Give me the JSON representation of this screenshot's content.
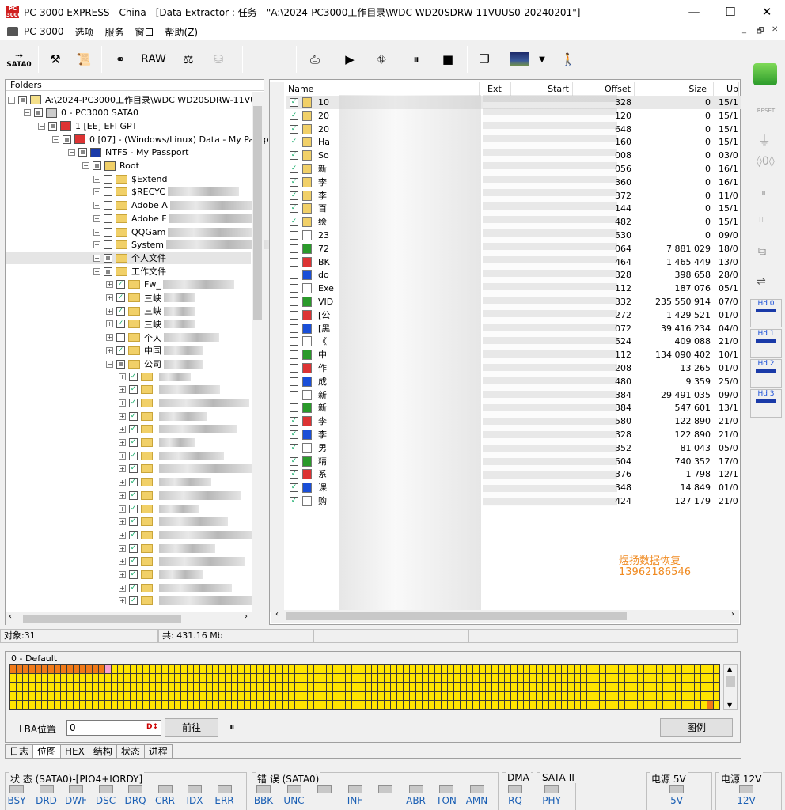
{
  "window": {
    "icon_text": "PC 3000",
    "title": "PC-3000 EXPRESS - China - [Data Extractor : 任务 - \"A:\\2024-PC3000工作目录\\WDC WD20SDRW-11VUUS0-20240201\"]",
    "minimize": "—",
    "maximize": "☐",
    "close": "✕"
  },
  "menu": {
    "items": [
      "PC-3000",
      "选项",
      "服务",
      "窗口",
      "帮助(Z)"
    ],
    "mdi": [
      "_",
      "🗗",
      "✕"
    ]
  },
  "toolbar": {
    "sata_label": "SATA0",
    "raw_label": "RAW"
  },
  "folders": {
    "header": "Folders",
    "rows": [
      {
        "label": "A:\\2024-PC3000工作目录\\WDC WD20SDRW-11VU",
        "blur": 0
      },
      {
        "label": "0 - PC3000 SATA0",
        "blur": 0
      },
      {
        "label": "1 [EE] EFI GPT",
        "blur": 0
      },
      {
        "label": "0 [07] - (Windows/Linux) Data - My Passpo",
        "blur": 0
      },
      {
        "label": "NTFS - My Passport",
        "blur": 0
      },
      {
        "label": "Root",
        "blur": 0
      },
      {
        "label": "$Extend",
        "blur": 0
      },
      {
        "label": "$RECYC",
        "blur": 90
      },
      {
        "label": "Adobe A",
        "blur": 110
      },
      {
        "label": "Adobe F",
        "blur": 120
      },
      {
        "label": "QQGam",
        "blur": 110
      },
      {
        "label": "System",
        "blur": 130
      },
      {
        "label": "个人文件",
        "blur": 0
      },
      {
        "label": "工作文件",
        "blur": 0
      },
      {
        "label": "Fw_",
        "blur": 90
      },
      {
        "label": "三峡",
        "blur": 40
      },
      {
        "label": "三峡",
        "blur": 40
      },
      {
        "label": "三峡",
        "blur": 40
      },
      {
        "label": "个人",
        "blur": 70
      },
      {
        "label": "中国",
        "blur": 50
      },
      {
        "label": "公司",
        "blur": 50
      }
    ],
    "sub_rows": 18
  },
  "filelist": {
    "columns": [
      "Name",
      "Ext",
      "Start",
      "Offset",
      "Size",
      "Up"
    ],
    "rows": [
      {
        "name": "10",
        "offset": "328",
        "size": "0",
        "date": "15/1"
      },
      {
        "name": "20",
        "offset": "120",
        "size": "0",
        "date": "15/1"
      },
      {
        "name": "20",
        "offset": "648",
        "size": "0",
        "date": "15/1"
      },
      {
        "name": "Ha",
        "offset": "160",
        "size": "0",
        "date": "15/1"
      },
      {
        "name": "So",
        "offset": "008",
        "size": "0",
        "date": "03/0"
      },
      {
        "name": "新",
        "offset": "056",
        "size": "0",
        "date": "16/1"
      },
      {
        "name": "李",
        "offset": "360",
        "size": "0",
        "date": "16/1"
      },
      {
        "name": "李",
        "offset": "372",
        "size": "0",
        "date": "11/0"
      },
      {
        "name": "百",
        "offset": "144",
        "size": "0",
        "date": "15/1"
      },
      {
        "name": "绘",
        "offset": "482",
        "size": "0",
        "date": "15/1"
      },
      {
        "name": "23",
        "offset": "530",
        "size": "0",
        "date": "09/0"
      },
      {
        "name": "72",
        "offset": "064",
        "size": "7 881 029",
        "date": "18/0"
      },
      {
        "name": "BK",
        "offset": "464",
        "size": "1 465 449",
        "date": "13/0"
      },
      {
        "name": "do",
        "offset": "328",
        "size": "398 658",
        "date": "28/0"
      },
      {
        "name": "Exe",
        "offset": "112",
        "size": "187 076",
        "date": "05/1"
      },
      {
        "name": "VID",
        "offset": "332",
        "size": "235 550 914",
        "date": "07/0"
      },
      {
        "name": "[公",
        "offset": "272",
        "size": "1 429 521",
        "date": "01/0"
      },
      {
        "name": "[黑",
        "offset": "072",
        "size": "39 416 234",
        "date": "04/0"
      },
      {
        "name": "《",
        "offset": "524",
        "size": "409 088",
        "date": "21/0"
      },
      {
        "name": "中",
        "offset": "112",
        "size": "134 090 402",
        "date": "10/1"
      },
      {
        "name": "作",
        "offset": "208",
        "size": "13 265",
        "date": "01/0"
      },
      {
        "name": "成",
        "offset": "480",
        "size": "9 359",
        "date": "25/0"
      },
      {
        "name": "新",
        "offset": "384",
        "size": "29 491 035",
        "date": "09/0"
      },
      {
        "name": "新",
        "offset": "384",
        "size": "547 601",
        "date": "13/1"
      },
      {
        "name": "李",
        "offset": "580",
        "size": "122 890",
        "date": "21/0"
      },
      {
        "name": "李",
        "offset": "328",
        "size": "122 890",
        "date": "21/0"
      },
      {
        "name": "男",
        "offset": "352",
        "size": "81 043",
        "date": "05/0"
      },
      {
        "name": "精",
        "offset": "504",
        "size": "740 352",
        "date": "17/0"
      },
      {
        "name": "系",
        "offset": "376",
        "size": "1 798",
        "date": "12/1"
      },
      {
        "name": "课",
        "offset": "348",
        "size": "14 849",
        "date": "01/0"
      },
      {
        "name": "购",
        "offset": "424",
        "size": "127 179",
        "date": "21/0"
      }
    ],
    "watermark_line1": "煜扬数据恢复",
    "watermark_line2": "13962186546"
  },
  "status": {
    "objects": "对象:31",
    "total": "共: 431.16 Mb"
  },
  "map": {
    "label": "0 - Default",
    "lba_label": "LBA位置",
    "lba_value": "0",
    "go_button": "前往",
    "pause": "⏸",
    "legend_button": "图例"
  },
  "tabs": [
    "日志",
    "位图",
    "HEX",
    "结构",
    "状态",
    "进程"
  ],
  "leds": {
    "state_title": "状 态 (SATA0)-[PIO4+IORDY]",
    "state": [
      "BSY",
      "DRD",
      "DWF",
      "DSC",
      "DRQ",
      "CRR",
      "IDX",
      "ERR"
    ],
    "error_title": "错 误 (SATA0)",
    "error": [
      "BBK",
      "UNC",
      "",
      "INF",
      "",
      "ABR",
      "TON",
      "AMN"
    ],
    "dma_title": "DMA",
    "dma": [
      "RQ"
    ],
    "sata_title": "SATA-II",
    "sata": [
      "PHY"
    ],
    "p5_title": "电源 5V",
    "p5": [
      "5V"
    ],
    "p12_title": "电源 12V",
    "p12": [
      "12V"
    ]
  },
  "rightbar": {
    "reset_label": "RESET",
    "hd": [
      "Hd 0",
      "Hd 1",
      "Hd 2",
      "Hd 3"
    ]
  }
}
